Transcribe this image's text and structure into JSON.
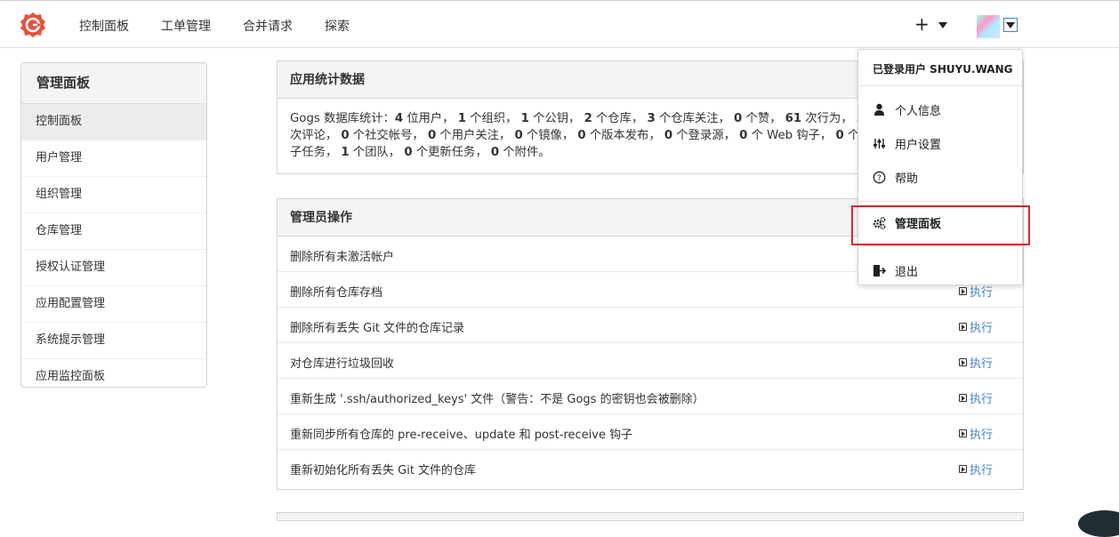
{
  "nav": {
    "items": [
      "控制面板",
      "工单管理",
      "合并请求",
      "探索"
    ],
    "plus": "+"
  },
  "sidebar": {
    "header": "管理面板",
    "items": [
      "控制面板",
      "用户管理",
      "组织管理",
      "仓库管理",
      "授权认证管理",
      "应用配置管理",
      "系统提示管理",
      "应用监控面板"
    ]
  },
  "stats": {
    "header": "应用统计数据",
    "line1_prefix": "Gogs 数据库统计：",
    "line1": "4|位用户，|1|个组织，|1|个公钥，|2|个仓库，|3|个仓库关注，|0|个赞，|61|次行为，|3",
    "line2": "次评论，|0|个社交帐号，|0|个用户关注，|0|个镜像，|0|个版本发布，|0|个登录源，|0|个 Web 钩子，|0|个里",
    "line3": "子任务，|1|个团队，|0|个更新任务，|0|个附件。"
  },
  "ops": {
    "header": "管理员操作",
    "exec_label": "执行",
    "rows": [
      "删除所有未激活帐户",
      "删除所有仓库存档",
      "删除所有丢失 Git 文件的仓库记录",
      "对仓库进行垃圾回收",
      "重新生成 '.ssh/authorized_keys' 文件（警告：不是 Gogs 的密钥也会被删除）",
      "重新同步所有仓库的 pre-receive、update 和 post-receive 钩子",
      "重新初始化所有丢失 Git 文件的仓库"
    ]
  },
  "dropdown": {
    "signed_in": "已登录用户 SHUYU.WANG",
    "items": [
      {
        "icon": "user-icon",
        "label": "个人信息"
      },
      {
        "icon": "sliders-icon",
        "label": "用户设置"
      },
      {
        "icon": "help-icon",
        "label": "帮助"
      },
      {
        "icon": "gears-icon",
        "label": "管理面板"
      },
      {
        "icon": "logout-icon",
        "label": "退出"
      }
    ]
  },
  "colors": {
    "link": "#4183c4",
    "highlight": "#d9282e",
    "logo": "#e5533d"
  }
}
